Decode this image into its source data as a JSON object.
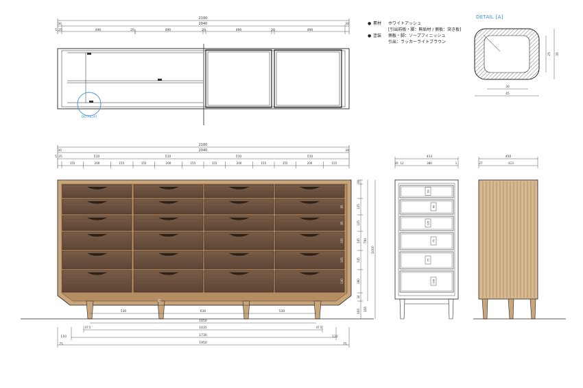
{
  "plan": {
    "dim_total": "2100",
    "dim_inner": "2040",
    "dim_row2": [
      "30",
      "490",
      "20",
      "490",
      "20",
      "490",
      "20",
      "490",
      "30"
    ],
    "dim_edge_small": [
      "5",
      "25"
    ],
    "detail_mark": "DETAIL[A]"
  },
  "front": {
    "dim_total": "2100",
    "dim_inner": "2040",
    "dim_row2": [
      "30",
      "510",
      "510",
      "510",
      "510",
      "30"
    ],
    "dim_edge_small": [
      "5",
      "25"
    ],
    "dim_row3": [
      "155",
      "200",
      "155",
      "155",
      "200",
      "155",
      "155",
      "200",
      "155",
      "155",
      "200",
      "155"
    ],
    "right_dims": [
      "34",
      "125",
      "125",
      "145",
      "145",
      "180",
      "34"
    ],
    "drawer_inner_dims": [
      "85",
      "85",
      "105",
      "105",
      "140"
    ],
    "height_main": "790",
    "height_total": "1000",
    "leg_dims": [
      "100",
      "150"
    ],
    "leg_spacing": [
      "530",
      "630",
      "530"
    ],
    "bottom_dims": {
      "d1650": "1650",
      "d1635": "1635",
      "d1730": "1730",
      "d1950": "1950",
      "small_a": "47.5",
      "small_b": "47.5",
      "side_110a": "110",
      "side_110b": "110",
      "side_75a": "75",
      "side_75b": "75",
      "leg_label": "45"
    }
  },
  "section": {
    "dim_total": "413",
    "dim_parts": [
      "20",
      "12",
      "380",
      "1"
    ],
    "shelf_labels": [
      "60",
      "60",
      "105",
      "75",
      "75",
      "100"
    ]
  },
  "side": {
    "dim_total": "450",
    "dim_parts": [
      "27",
      "423"
    ]
  },
  "detail": {
    "title": "DETAIL [A]",
    "dim_width_outer": "45",
    "dim_width_inner": "30",
    "dim_height_outer": "35",
    "dim_height_inner": "25"
  },
  "notes": [
    {
      "bullet": "●",
      "key": "素材",
      "value": "ホワイトアッシュ"
    },
    {
      "bullet": "",
      "key": "",
      "value": "[引出前板・脚：無垢材 / 側板：突き板]"
    },
    {
      "bullet": "●",
      "key": "塗装",
      "value": "側板・脚：ソープフィニッシュ"
    },
    {
      "bullet": "",
      "key": "",
      "value": "引出：ラッカーライトブラウン"
    }
  ],
  "colors": {
    "line": "#222222",
    "dim": "#555555",
    "wood": "#c9a57c",
    "drawer": "#6d5240",
    "drawer_dark": "#4d3a2c",
    "accent": "#3a8fd6"
  }
}
